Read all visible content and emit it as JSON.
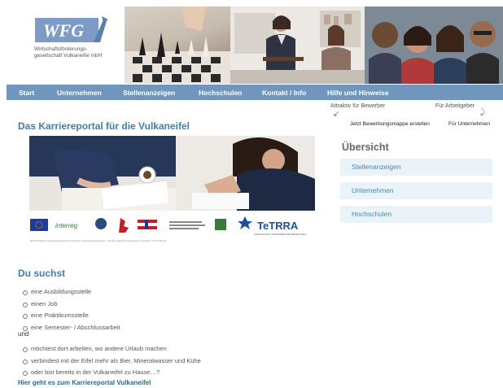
{
  "header": {
    "logo_mark": "WFG",
    "logo_line1": "Wirtschaftsförderungs-",
    "logo_line2": "gesellschaft Vulkaneifel mbH"
  },
  "nav": [
    "Start",
    "Unternehmen",
    "Stellenanzeigen",
    "Hochschulen",
    "Kontakt / Info",
    "Hilfe und Hinweise"
  ],
  "main": {
    "title": "Das Karriereportal für die Vulkaneifel",
    "hero_caption": "Mit Unterstützung des Europäischen Fonds für regionale Entwicklung – Die Europäische Kommission investiert in Ihre Zukunft",
    "partner_logo": "TeTRRA",
    "partner_sub": "TECHNOLOGY TRANSFER AND RECRUITING",
    "section_title": "Du suchst",
    "list1": [
      "eine Ausbildungsstelle",
      "einen Job",
      "eine Praktikumsstelle",
      "eine Semester- / Abschlussarbeit"
    ],
    "und": "und",
    "list2": [
      "möchtest dort arbeiten, wo andere Urlaub machen",
      "verbindest mit der Eifel mehr als Bier, Mineralwasser und Kühe",
      "oder bist bereits in der Vulkaneifel zu Hause…?"
    ],
    "cta": "Hier geht es zum Karriereportal Vulkaneifel"
  },
  "sidebar": {
    "top_left": "Attraktiv für Bewerber",
    "top_right": "Für Arbeitgeber",
    "link_left": "Jetzt Bewerbungsmappe erstellen",
    "link_right": "Für Unternehmen",
    "title": "Übersicht",
    "items": [
      "Stellenanzeigen",
      "Unternehmen",
      "Hochschulen"
    ]
  },
  "colors": {
    "nav": "#7096bd",
    "heading": "#3f7fa8",
    "side_item_bg": "#eaf3f7",
    "side_item_text": "#3d8db0"
  }
}
